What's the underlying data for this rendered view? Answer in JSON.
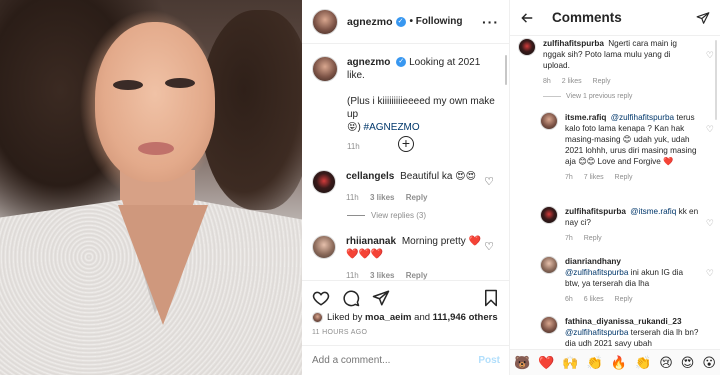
{
  "post": {
    "username": "agnezmo",
    "follow_status": "• Following",
    "more_icon": "more-dots-icon",
    "caption": {
      "username": "agnezmo",
      "text": "Looking at 2021 like.",
      "text2": "(Plus i kiiiiiiiiieeeed my own make up",
      "emoji": "😝",
      "hashtag": "#AGNEZMO"
    },
    "caption_time": "11h",
    "comments": [
      {
        "username": "cellangels",
        "text": "Beautiful ka 😍😍",
        "time": "11h",
        "likes": "3 likes",
        "reply": "Reply"
      },
      {
        "username": "rhiiananak",
        "text": "Morning pretty ❤️❤️❤️❤️",
        "time": "11h",
        "likes": "3 likes",
        "reply": "Reply"
      }
    ],
    "view_replies": "View replies (3)",
    "liked_by": {
      "prefix": "Liked by",
      "user": "moa_aeim",
      "middle": "and",
      "count": "111,946 others"
    },
    "time_ago": "11 HOURS AGO",
    "add_comment_placeholder": "Add a comment...",
    "post_button": "Post"
  },
  "comments_panel": {
    "title": "Comments",
    "items": [
      {
        "username": "zulfihafitspurba",
        "text": "Ngerti cara main ig nggak sih? Poto lama mulu yang di upload.",
        "time": "8h",
        "likes": "2 likes",
        "reply": "Reply"
      },
      {
        "username": "itsme.rafiq",
        "mention": "@zulfihafitspurba",
        "text": "terus kalo foto lama kenapa ? Kan hak masing-masing 😊 udah yuk, udah 2021 lohhh, urus diri masing masing aja 😊😊 Love and Forgive ❤️",
        "time": "7h",
        "likes": "7 likes",
        "reply": "Reply"
      },
      {
        "username": "zulfihafitspurba",
        "mention": "@itsme.rafiq",
        "text": "kk en nay ci?",
        "time": "7h",
        "reply": "Reply"
      },
      {
        "username": "dianriandhany",
        "mention": "@zulfihafitspurba",
        "text": "ini akun IG dia btw, ya terserah dia lha",
        "time": "6h",
        "likes": "6 likes",
        "reply": "Reply"
      },
      {
        "username": "fathina_diyanissa_rukandi_23",
        "mention": "@zulfihafitspurba",
        "text": "terserah dia lh bn? dia udh 2021 savy ubah"
      }
    ],
    "view_replies": "View 1 previous reply",
    "emojis": [
      "🐻",
      "❤️",
      "🙌",
      "👏",
      "🔥",
      "👏",
      "😢",
      "😍",
      "😮"
    ]
  },
  "colors": {
    "accent": "#3897f0",
    "link": "#00376b",
    "muted": "#8e8e8e",
    "heart_red": "#ed4956"
  }
}
